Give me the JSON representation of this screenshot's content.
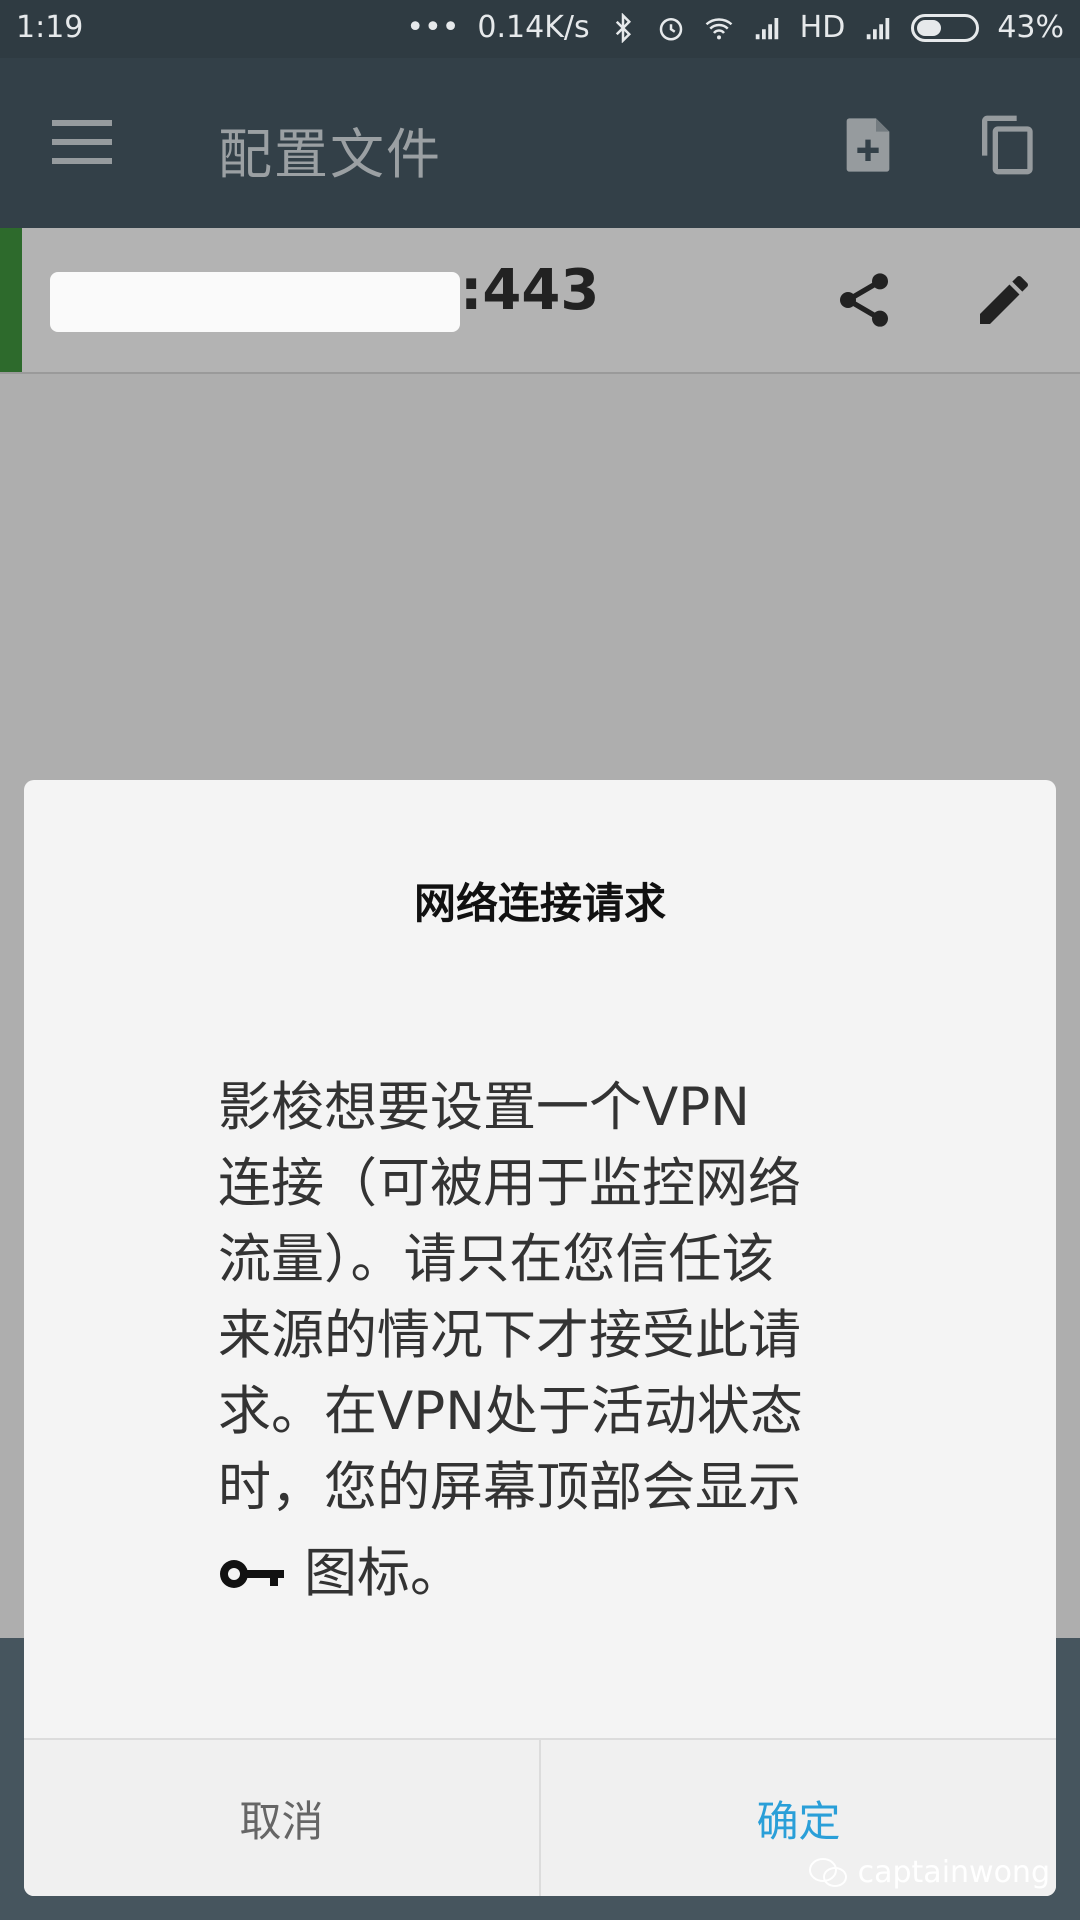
{
  "status_bar": {
    "time": "1:19",
    "network_speed": "0.14K/s",
    "signal_label": "HD",
    "battery": "43%",
    "battery_level": 0.43
  },
  "app_bar": {
    "title": "配置文件",
    "icons": [
      "menu-icon",
      "new-file-icon",
      "copy-icon"
    ]
  },
  "profile_item": {
    "host_suffix": ":443",
    "icons": [
      "share-icon",
      "edit-icon"
    ]
  },
  "dialog": {
    "title": "网络连接请求",
    "body_lines": [
      "影梭想要设置一个VPN",
      "连接（可被用于监控网络",
      "流量）。请只在您信任该",
      "来源的情况下才接受此请",
      "求。在VPN处于活动状态",
      "时，您的屏幕顶部会显示"
    ],
    "body_end": "图标。",
    "cancel_label": "取消",
    "ok_label": "确定"
  },
  "watermark": "captainwong",
  "colors": {
    "accent_ok": "#2a9fd8",
    "cancel_text": "#666666",
    "active_indicator": "#2d6a2c",
    "app_bar": "#445661"
  }
}
